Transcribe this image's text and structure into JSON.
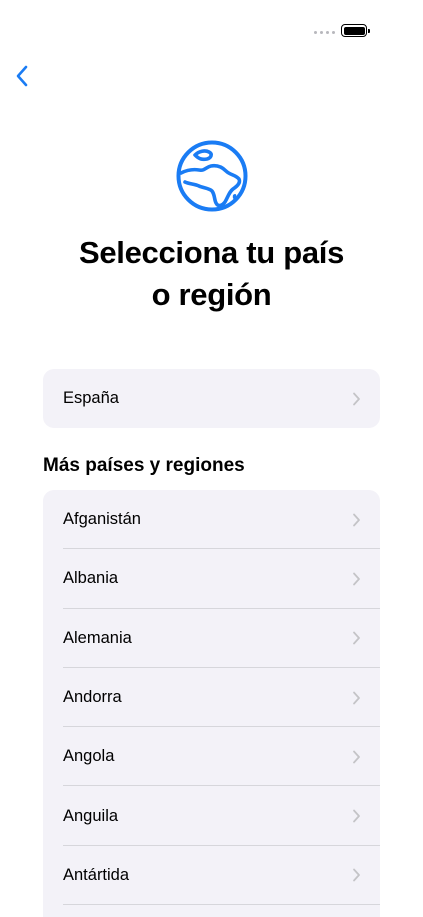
{
  "status_bar": {
    "signal_icon": "signal-dots-icon",
    "battery_icon": "battery-icon",
    "battery_level": 1.0
  },
  "nav": {
    "back_icon": "chevron-left-icon",
    "accent_color": "#1a7cf4"
  },
  "hero": {
    "icon": "globe-africa-icon",
    "title": "Selecciona tu país o región"
  },
  "suggested": {
    "items": [
      {
        "label": "España"
      }
    ]
  },
  "more": {
    "header": "Más países y regiones",
    "items": [
      {
        "label": "Afganistán"
      },
      {
        "label": "Albania"
      },
      {
        "label": "Alemania"
      },
      {
        "label": "Andorra"
      },
      {
        "label": "Angola"
      },
      {
        "label": "Anguila"
      },
      {
        "label": "Antártida"
      }
    ]
  },
  "colors": {
    "card_background": "#f3f2f8",
    "chevron": "#c4c4c7",
    "separator": "#d6d6db"
  }
}
